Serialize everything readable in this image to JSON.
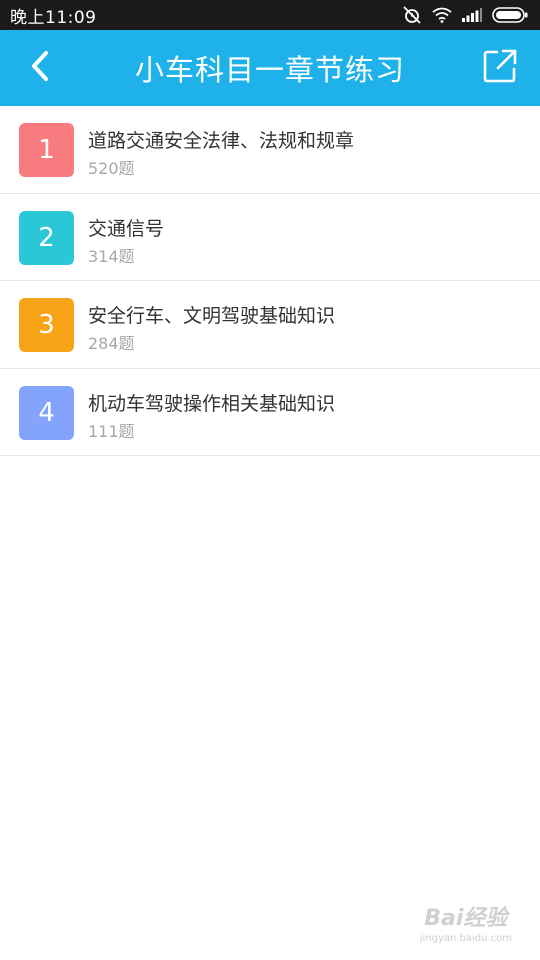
{
  "status_bar": {
    "time": "晚上11:09",
    "icons": [
      "alarm-off-icon",
      "wifi-icon",
      "signal-icon",
      "battery-icon"
    ]
  },
  "header": {
    "title": "小车科目一章节练习",
    "back_icon": "chevron-left-icon",
    "share_icon": "share-external-icon",
    "background_color": "#1fb2ea"
  },
  "chapters": [
    {
      "number": "1",
      "title": "道路交通安全法律、法规和规章",
      "count": "520题",
      "color": "#f87b80"
    },
    {
      "number": "2",
      "title": "交通信号",
      "count": "314题",
      "color": "#2ac7d6"
    },
    {
      "number": "3",
      "title": "安全行车、文明驾驶基础知识",
      "count": "284题",
      "color": "#f8a417"
    },
    {
      "number": "4",
      "title": "机动车驾驶操作相关基础知识",
      "count": "111题",
      "color": "#83a3fd"
    }
  ],
  "watermark": {
    "main": "Bai经验",
    "sub": "jingyan.baidu.com"
  }
}
